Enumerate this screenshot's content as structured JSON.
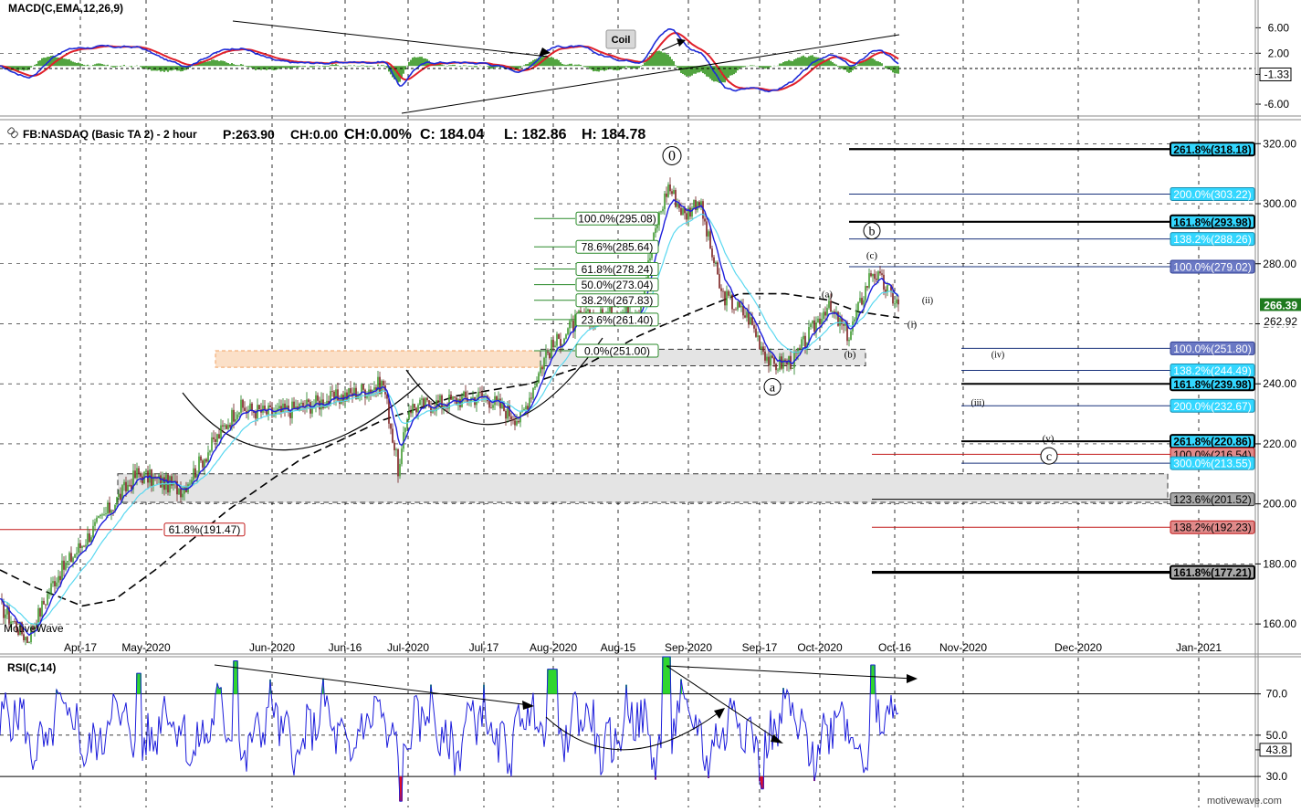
{
  "colors": {
    "price_line": "#111111",
    "ema_fast": "#1d1ddb",
    "ema_slow": "#5ad8f0",
    "macd_line": "#1e2bd8",
    "signal_line": "#e0202a",
    "hist": "#3f9a2c",
    "rsi_line": "#1d1ddb",
    "rsi_fill_hi": "#2fd62f",
    "rsi_fill_lo": "#e0102a",
    "fib_black": "#000000",
    "fib_navy": "#17307a",
    "fib_red": "#c21a1a",
    "fib_green": "#2a8a2a",
    "label_cyan": "#33d7ff",
    "label_navy": "#2f3e93",
    "label_grey": "#888888",
    "label_red": "#d04a4a",
    "zone_orange": "#f9d6b8"
  },
  "macd": {
    "title": "MACD(C,EMA,12,26,9)",
    "ticks": [
      "6.00",
      "2.00",
      "-1.33",
      "-6.00"
    ],
    "tick_values": [
      6,
      2,
      -1.33,
      -6
    ],
    "range": [
      -7,
      9.5
    ],
    "current": -1.33,
    "annotation": "Coil"
  },
  "price": {
    "title": "FB:NASDAQ (Basic TA 2) - 2 hour",
    "stats": [
      "P:263.90",
      "CH:0.00",
      "CH:0.00%",
      "C: 184.04",
      "L: 182.86",
      "H: 184.78"
    ],
    "ylim": [
      150,
      328
    ],
    "yticks": [
      "320.00",
      "300.00",
      "280.00",
      "260.00",
      "240.00",
      "220.00",
      "200.00",
      "180.00",
      "160.00"
    ],
    "ytick_values": [
      320,
      300,
      280,
      260,
      240,
      220,
      200,
      180,
      160
    ],
    "last_price": "266.39",
    "last_price_value": 266.39,
    "prev_label": "262.92",
    "prev_label_value": 262.92,
    "watermark": "MotiveWave",
    "xaxis": [
      "Apr-17",
      "May-2020",
      "Jun-2020",
      "Jun-16",
      "Jul-2020",
      "Jul-17",
      "Aug-2020",
      "Aug-15",
      "Sep-2020",
      "Sep-17",
      "Oct-2020",
      "Oct-16",
      "Nov-2020",
      "Dec-2020",
      "Jan-2021"
    ]
  },
  "retracement_labels": [
    {
      "text": "100.0%(295.08)",
      "value": 295.08
    },
    {
      "text": "78.6%(285.64)",
      "value": 285.64
    },
    {
      "text": "61.8%(278.24)",
      "value": 278.24
    },
    {
      "text": "50.0%(273.04)",
      "value": 273.04
    },
    {
      "text": "38.2%(267.83)",
      "value": 267.83
    },
    {
      "text": "23.6%(261.40)",
      "value": 261.4
    },
    {
      "text": "0.0%(251.00)",
      "value": 251.0
    },
    {
      "text": "61.8%(191.47)",
      "value": 191.47
    }
  ],
  "extension_labels": [
    {
      "text": "261.8%(318.18)",
      "value": 318.18,
      "style": "cyan-bold"
    },
    {
      "text": "200.0%(303.22)",
      "value": 303.22,
      "style": "cyan"
    },
    {
      "text": "161.8%(293.98)",
      "value": 293.98,
      "style": "cyan-bold"
    },
    {
      "text": "138.2%(288.26)",
      "value": 288.26,
      "style": "cyan"
    },
    {
      "text": "100.0%(279.02)",
      "value": 279.02,
      "style": "navy"
    },
    {
      "text": "100.0%(251.80)",
      "value": 251.8,
      "style": "navy"
    },
    {
      "text": "138.2%(244.49)",
      "value": 244.49,
      "style": "cyan"
    },
    {
      "text": "161.8%(239.98)",
      "value": 239.98,
      "style": "cyan-bold"
    },
    {
      "text": "200.0%(232.67)",
      "value": 232.67,
      "style": "cyan"
    },
    {
      "text": "261.8%(220.86)",
      "value": 220.86,
      "style": "cyan-bold"
    },
    {
      "text": "100.0%(216.54)",
      "value": 216.54,
      "style": "red"
    },
    {
      "text": "300.0%(213.55)",
      "value": 213.55,
      "style": "cyan"
    },
    {
      "text": "123.6%(201.52)",
      "value": 201.52,
      "style": "grey"
    },
    {
      "text": "138.2%(192.23)",
      "value": 192.23,
      "style": "red"
    },
    {
      "text": "161.8%(177.21)",
      "value": 177.21,
      "style": "grey-bold"
    }
  ],
  "wave_labels": [
    {
      "text": "0",
      "circled": true,
      "price": 316
    },
    {
      "text": "b",
      "circled": true,
      "price": 291
    },
    {
      "text": "(c)",
      "circled": false,
      "price": 283
    },
    {
      "text": "(a)",
      "circled": false,
      "price": 270
    },
    {
      "text": "(ii)",
      "circled": false,
      "price": 268
    },
    {
      "text": "(i)",
      "circled": false,
      "price": 260
    },
    {
      "text": "(b)",
      "circled": false,
      "price": 250
    },
    {
      "text": "(iv)",
      "circled": false,
      "price": 250
    },
    {
      "text": "a",
      "circled": true,
      "price": 239
    },
    {
      "text": "(iii)",
      "circled": false,
      "price": 234
    },
    {
      "text": "(v)",
      "circled": false,
      "price": 222
    },
    {
      "text": "c",
      "circled": true,
      "price": 216
    }
  ],
  "rsi": {
    "title": "RSI(C,14)",
    "ticks": [
      "70.0",
      "50.0",
      "43.8",
      "30.0"
    ],
    "tick_values": [
      70,
      50,
      43.8,
      30
    ],
    "range": [
      15,
      88
    ],
    "current": 43.8,
    "footer": "motivewave.com"
  },
  "chart_data": [
    {
      "type": "line",
      "title": "MACD(C,EMA,12,26,9)",
      "current_macd": -1.33,
      "ylim": [
        -7,
        9.5
      ],
      "series": [
        {
          "name": "MACD",
          "note": "oscillates between approx -6 and 8"
        },
        {
          "name": "Signal"
        },
        {
          "name": "Histogram"
        }
      ]
    },
    {
      "type": "line",
      "title": "FB:NASDAQ (Basic TA 2) - 2 hour",
      "x": [
        "Apr-17",
        "May-2020",
        "Jun-2020",
        "Jun-16",
        "Jul-2020",
        "Jul-17",
        "Aug-2020",
        "Aug-15",
        "Sep-2020",
        "Sep-17",
        "Oct-2020",
        "Oct-16"
      ],
      "series": [
        {
          "name": "FB",
          "values": [
            168,
            202,
            228,
            235,
            232,
            236,
            252,
            265,
            300,
            250,
            262,
            266
          ]
        }
      ],
      "ylim": [
        150,
        328
      ],
      "swing_high": 304,
      "swing_low": 155
    },
    {
      "type": "line",
      "title": "RSI(C,14)",
      "ylim": [
        15,
        88
      ],
      "levels": [
        70,
        50,
        30
      ],
      "current": 43.8
    }
  ]
}
